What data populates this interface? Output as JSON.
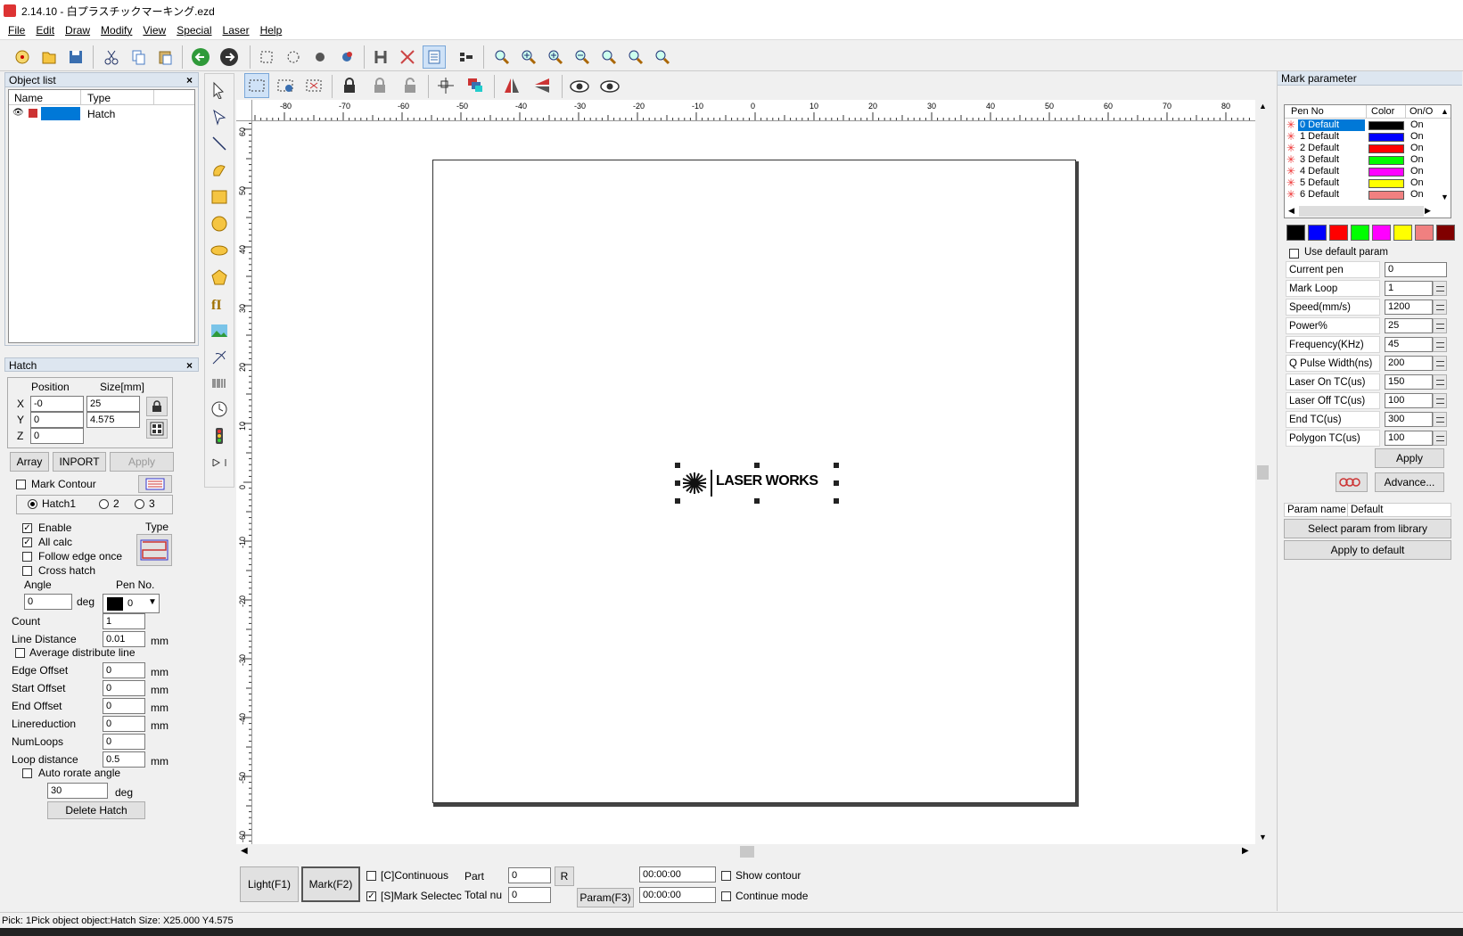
{
  "window": {
    "title": "2.14.10 - 白プラスチックマーキング.ezd"
  },
  "menu": [
    "File",
    "Edit",
    "Draw",
    "Modify",
    "View",
    "Special",
    "Laser",
    "Help"
  ],
  "object_list": {
    "title": "Object list",
    "col_name": "Name",
    "col_type": "Type",
    "rows": [
      {
        "name": "",
        "type": "Hatch"
      }
    ]
  },
  "hatch_panel": {
    "title": "Hatch",
    "position_label": "Position",
    "size_label": "Size[mm]",
    "x_label": "X",
    "y_label": "Y",
    "z_label": "Z",
    "pos_x": "-0",
    "pos_y": "0",
    "pos_z": "0",
    "size_x": "25",
    "size_y": "4.575",
    "array_btn": "Array",
    "inport_btn": "INPORT",
    "apply_btn": "Apply",
    "mark_contour": "Mark Contour",
    "hatch1": "Hatch1",
    "hatch2": "2",
    "hatch3": "3",
    "enable": "Enable",
    "all_calc": "All calc",
    "follow_edge": "Follow edge once",
    "cross_hatch": "Cross hatch",
    "type_label": "Type",
    "angle_label": "Angle",
    "angle": "0",
    "deg": "deg",
    "pen_no_label": "Pen No.",
    "pen_no": "0",
    "count_label": "Count",
    "count": "1",
    "line_distance_label": "Line Distance",
    "line_distance": "0.01",
    "mm": "mm",
    "avg_distribute": "Average distribute line",
    "edge_offset_label": "Edge Offset",
    "edge_offset": "0",
    "start_offset_label": "Start Offset",
    "start_offset": "0",
    "end_offset_label": "End Offset",
    "end_offset": "0",
    "linereduction_label": "Linereduction",
    "linereduction": "0",
    "numloops_label": "NumLoops",
    "numloops": "0",
    "loop_distance_label": "Loop distance",
    "loop_distance": "0.5",
    "auto_rotate": "Auto rorate angle",
    "auto_rotate_value": "30",
    "delete_hatch": "Delete Hatch"
  },
  "ruler": {
    "top_ticks": [
      "-80",
      "-70",
      "-60",
      "-50",
      "-40",
      "-30",
      "-20",
      "-10",
      "0",
      "10",
      "20",
      "30",
      "40",
      "50",
      "60",
      "70",
      "80"
    ],
    "left_ticks": [
      "60",
      "50",
      "40",
      "30",
      "20",
      "10",
      "0",
      "-10",
      "-20",
      "-30",
      "-40",
      "-50",
      "-60"
    ]
  },
  "canvas": {
    "logo_text": "LASER WORKS"
  },
  "bottom_controls": {
    "light_btn": "Light(F1)",
    "mark_btn": "Mark(F2)",
    "continuous": "[C]Continuous",
    "mark_selected": "[S]Mark Selectec",
    "part_label": "Part",
    "part_value": "0",
    "r_btn": "R",
    "total_label": "Total nu",
    "total_value": "0",
    "param_btn": "Param(F3)",
    "time1": "00:00:00",
    "time2": "00:00:00",
    "show_contour": "Show contour",
    "continue_mode": "Continue mode"
  },
  "mark_parameter": {
    "title": "Mark parameter",
    "col_pen": "Pen No",
    "col_color": "Color",
    "col_onoff": "On/O",
    "pens": [
      {
        "label": "0 Default",
        "color": "#000000",
        "state": "On"
      },
      {
        "label": "1 Default",
        "color": "#0000ff",
        "state": "On"
      },
      {
        "label": "2 Default",
        "color": "#ff0000",
        "state": "On"
      },
      {
        "label": "3 Default",
        "color": "#00ff00",
        "state": "On"
      },
      {
        "label": "4 Default",
        "color": "#ff00ff",
        "state": "On"
      },
      {
        "label": "5 Default",
        "color": "#ffff00",
        "state": "On"
      },
      {
        "label": "6 Default",
        "color": "#f08080",
        "state": "On"
      }
    ],
    "palette": [
      "#000000",
      "#0000ff",
      "#ff0000",
      "#00ff00",
      "#ff00ff",
      "#ffff00",
      "#f08080",
      "#800000"
    ],
    "use_default": "Use default param",
    "current_pen_label": "Current pen",
    "current_pen": "0",
    "params": [
      {
        "label": "Mark Loop",
        "value": "1"
      },
      {
        "label": "Speed(mm/s)",
        "value": "1200"
      },
      {
        "label": "Power%",
        "value": "25"
      },
      {
        "label": "Frequency(KHz)",
        "value": "45"
      },
      {
        "label": "Q Pulse Width(ns)",
        "value": "200"
      },
      {
        "label": "Laser On TC(us)",
        "value": "150"
      },
      {
        "label": "Laser Off TC(us)",
        "value": "100"
      },
      {
        "label": "End TC(us)",
        "value": "300"
      },
      {
        "label": "Polygon TC(us)",
        "value": "100"
      }
    ],
    "apply_btn": "Apply",
    "advance_btn": "Advance...",
    "param_name_label": "Param name",
    "param_name": "Default",
    "select_library_btn": "Select param from library",
    "apply_default_btn": "Apply to default"
  },
  "status": {
    "text": "Pick: 1Pick object object:Hatch Size: X25.000 Y4.575"
  }
}
